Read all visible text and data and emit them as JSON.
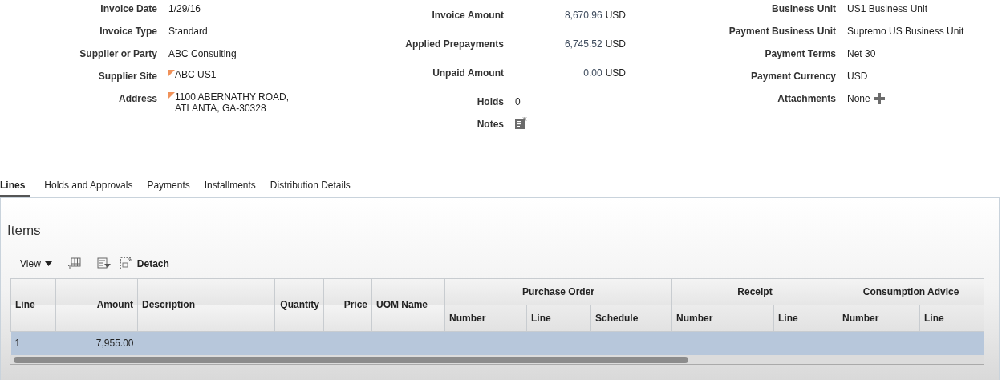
{
  "header": {
    "columns": [
      [
        {
          "label": "Invoice Date",
          "value": "1/29/16",
          "kind": "text"
        },
        {
          "label": "Invoice Type",
          "value": "Standard",
          "kind": "text"
        },
        {
          "label": "Supplier or Party",
          "value": "ABC Consulting",
          "kind": "text"
        },
        {
          "label": "Supplier Site",
          "value": "ABC US1",
          "kind": "flagged"
        },
        {
          "label": "Address",
          "value": "1100 ABERNATHY ROAD,",
          "value2": "ATLANTA, GA-30328",
          "kind": "flagged"
        }
      ],
      [
        {
          "label": "Invoice Amount",
          "value": "8,670.96",
          "unit": "USD",
          "kind": "amount"
        },
        {
          "label": "Applied Prepayments",
          "value": "6,745.52",
          "unit": "USD",
          "kind": "amount"
        },
        {
          "label": "Unpaid Amount",
          "value": "0.00",
          "unit": "USD",
          "kind": "amount"
        },
        {
          "label": "Holds",
          "value": "0",
          "kind": "text"
        },
        {
          "label": "Notes",
          "kind": "notes"
        }
      ],
      [
        {
          "label": "Business Unit",
          "value": "US1 Business Unit",
          "kind": "text"
        },
        {
          "label": "Payment Business Unit",
          "value": "Supremo US Business Unit",
          "kind": "text"
        },
        {
          "label": "Payment Terms",
          "value": "Net 30",
          "kind": "text"
        },
        {
          "label": "Payment Currency",
          "value": "USD",
          "kind": "text"
        },
        {
          "label": "Attachments",
          "value": "None",
          "kind": "attachments"
        }
      ]
    ]
  },
  "tabs": [
    {
      "label": "Lines",
      "selected": true
    },
    {
      "label": "Holds and Approvals",
      "selected": false
    },
    {
      "label": "Payments",
      "selected": false
    },
    {
      "label": "Installments",
      "selected": false
    },
    {
      "label": "Distribution Details",
      "selected": false
    }
  ],
  "items": {
    "title": "Items",
    "toolbar": {
      "view": "View",
      "detach": "Detach"
    },
    "table": {
      "columns": [
        {
          "label": "Line",
          "kind": "text"
        },
        {
          "label": "Amount",
          "kind": "numeric"
        },
        {
          "label": "Description",
          "kind": "text"
        },
        {
          "label": "Quantity",
          "kind": "numeric"
        },
        {
          "label": "Price",
          "kind": "numeric"
        },
        {
          "label": "UOM Name",
          "kind": "text"
        },
        {
          "group": "Purchase Order",
          "children": [
            "Number",
            "Line",
            "Schedule"
          ]
        },
        {
          "group": "Receipt",
          "children": [
            "Number",
            "Line"
          ]
        },
        {
          "group": "Consumption Advice",
          "children": [
            "Number",
            "Line"
          ]
        }
      ],
      "rows": [
        {
          "selected": true,
          "cells": [
            "1",
            "7,955.00",
            "",
            "",
            "",
            "",
            "",
            "",
            "",
            "",
            "",
            "",
            ""
          ]
        }
      ]
    }
  }
}
